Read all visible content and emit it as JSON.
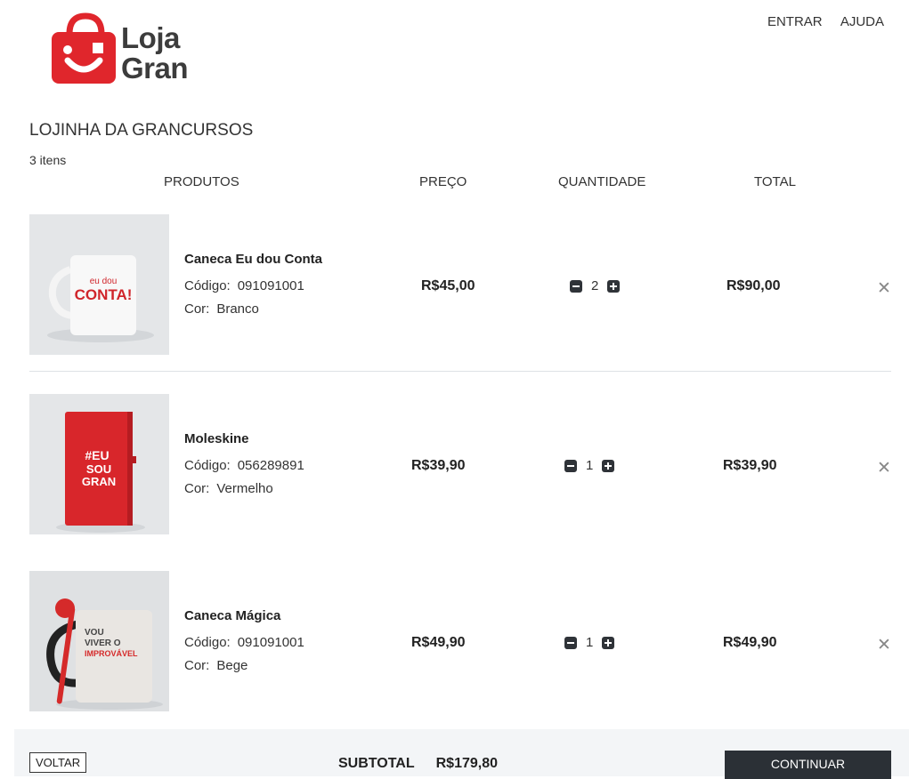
{
  "brand": {
    "name_line1": "Loja",
    "name_line2": "Gran",
    "color": "#e0262c"
  },
  "nav": {
    "login": "ENTRAR",
    "help": "AJUDA"
  },
  "store": {
    "title": "LOJINHA DA GRANCURSOS",
    "count": "3 itens"
  },
  "columns": {
    "products": "PRODUTOS",
    "price": "PREÇO",
    "quantity": "QUANTIDADE",
    "total": "TOTAL"
  },
  "items": [
    {
      "name": "Caneca Eu dou Conta",
      "code_label": "Código:",
      "code": "091091001",
      "color_label": "Cor:",
      "color": "Branco",
      "price": "R$45,00",
      "qty": "2",
      "total": "R$90,00",
      "image": {
        "text1": "eu dou",
        "text2": "CONTA!"
      }
    },
    {
      "name": "Moleskine",
      "code_label": "Código:",
      "code": "056289891",
      "color_label": "Cor:",
      "color": "Vermelho",
      "price": "R$39,90",
      "qty": "1",
      "total": "R$39,90",
      "image": {
        "text1": "#EU",
        "text2": "SOU",
        "text3": "GRAN"
      }
    },
    {
      "name": "Caneca Mágica",
      "code_label": "Código:",
      "code": "091091001",
      "color_label": "Cor:",
      "color": "Bege",
      "price": "R$49,90",
      "qty": "1",
      "total": "R$49,90",
      "image": {
        "text1": "VOU",
        "text2": "VIVER O",
        "text3": "IMPROVÁVEL"
      }
    }
  ],
  "footer": {
    "back": "VOLTAR",
    "subtotal_label": "SUBTOTAL",
    "subtotal": "R$179,80",
    "continue": "CONTINUAR"
  },
  "icons": {
    "minus": "minus-square-icon",
    "plus": "plus-square-icon",
    "remove": "close-icon",
    "bag": "shopping-bag-icon"
  }
}
